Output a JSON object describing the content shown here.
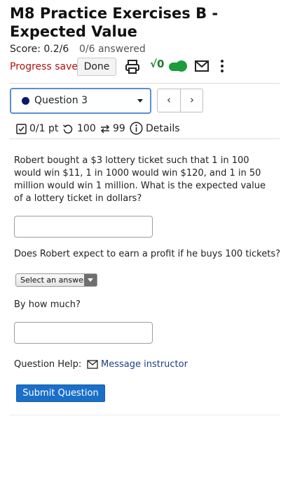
{
  "header": {
    "title": "M8 Practice Exercises B - Expected Value",
    "score": "Score: 0.2/6",
    "answered": "0/6 answered",
    "progress_status": "Progress saved",
    "done_label": "Done",
    "math_toggle_label": "√0"
  },
  "question_nav": {
    "selected": "Question 3",
    "prev_label": "‹",
    "next_label": "›"
  },
  "question_meta": {
    "points": "0/1 pt",
    "retries": "100",
    "attempts": "99",
    "details_label": "Details"
  },
  "question": {
    "text": "Robert bought a $3 lottery ticket such that 1 in 100 would win $11, 1 in 1000 would win $120, and 1 in 50 million would win 1 million. What is the expected value of a lottery ticket in dollars?",
    "part2_text": "Does Robert expect to earn a profit if he buys 100 tickets?",
    "answer_select_label": "Select an answer",
    "part3_text": "By how much?"
  },
  "help": {
    "label": "Question Help:",
    "link_label": "Message instructor"
  },
  "submit_label": "Submit Question",
  "colors": {
    "accent": "#1a6fc9",
    "progress_saved": "#b01010",
    "toggle_on": "#1a9d3a",
    "question_dot": "#0a1a6b",
    "link": "#1f3c88"
  }
}
